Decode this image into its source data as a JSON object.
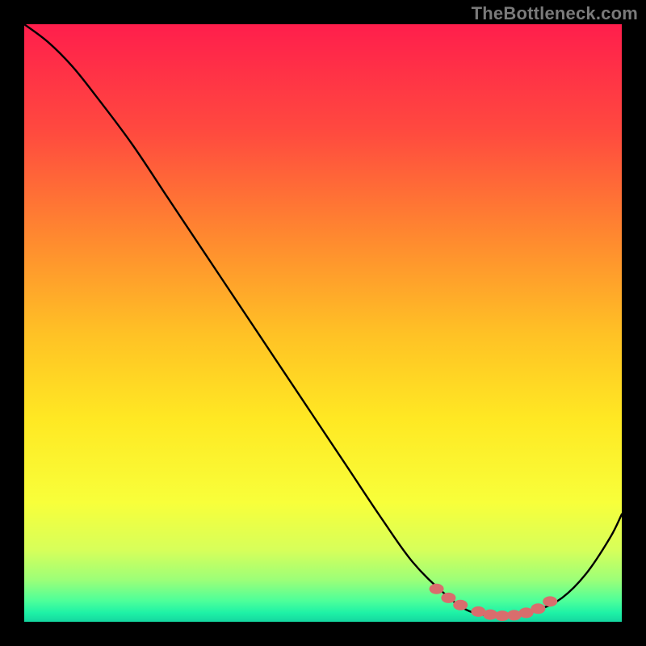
{
  "watermark": "TheBottleneck.com",
  "chart_data": {
    "type": "line",
    "title": "",
    "xlabel": "",
    "ylabel": "",
    "xlim": [
      0,
      100
    ],
    "ylim": [
      0,
      100
    ],
    "grid": false,
    "series": [
      {
        "name": "curve",
        "x": [
          0,
          4,
          8,
          12,
          18,
          24,
          30,
          36,
          42,
          48,
          54,
          60,
          65,
          70,
          74,
          78,
          82,
          86,
          90,
          94,
          98,
          100
        ],
        "y": [
          100,
          97,
          93,
          88,
          80,
          71,
          62,
          53,
          44,
          35,
          26,
          17,
          10,
          5,
          2,
          1,
          1,
          2,
          4,
          8,
          14,
          18
        ]
      }
    ],
    "markers": {
      "name": "highlight-dots",
      "color": "#d96d6d",
      "x": [
        69,
        71,
        73,
        76,
        78,
        80,
        82,
        84,
        86,
        88
      ],
      "y": [
        5.5,
        4.0,
        2.8,
        1.7,
        1.2,
        1.0,
        1.1,
        1.5,
        2.2,
        3.4
      ]
    },
    "background_gradient": {
      "stops": [
        {
          "offset": 0.0,
          "color": "#ff1e4c"
        },
        {
          "offset": 0.18,
          "color": "#ff4a3f"
        },
        {
          "offset": 0.36,
          "color": "#ff8a2f"
        },
        {
          "offset": 0.52,
          "color": "#ffc225"
        },
        {
          "offset": 0.66,
          "color": "#ffe823"
        },
        {
          "offset": 0.8,
          "color": "#f8ff3a"
        },
        {
          "offset": 0.88,
          "color": "#d7ff5a"
        },
        {
          "offset": 0.93,
          "color": "#9cff78"
        },
        {
          "offset": 0.965,
          "color": "#4dff9a"
        },
        {
          "offset": 0.985,
          "color": "#1ef2a6"
        },
        {
          "offset": 1.0,
          "color": "#14d6a0"
        }
      ]
    }
  }
}
